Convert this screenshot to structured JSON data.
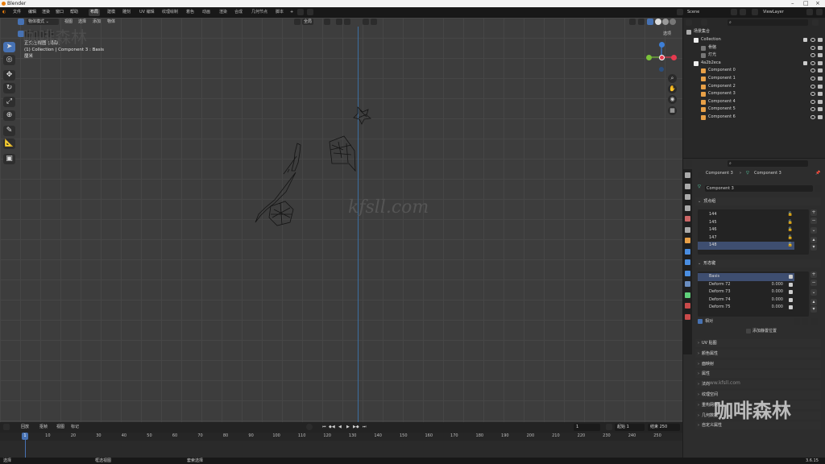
{
  "title_bar": {
    "title": "Blender"
  },
  "menus": [
    "文件",
    "编辑",
    "渲染",
    "窗口",
    "帮助"
  ],
  "workspaces": [
    {
      "label": "布局",
      "active": true
    },
    {
      "label": "建模"
    },
    {
      "label": "雕刻"
    },
    {
      "label": "UV 编辑"
    },
    {
      "label": "纹理绘制"
    },
    {
      "label": "着色"
    },
    {
      "label": "动画"
    },
    {
      "label": "渲染"
    },
    {
      "label": "合成"
    },
    {
      "label": "几何节点"
    },
    {
      "label": "脚本"
    }
  ],
  "scene": {
    "name": "Scene",
    "view_layer": "ViewLayer"
  },
  "viewport": {
    "mode": "物体模式",
    "menus": [
      "视图",
      "选择",
      "添加",
      "物体"
    ],
    "transform_orientation": "全局",
    "options_label": "选项",
    "overlay_lines": [
      "正交左视图 (局部)",
      "(1) Collection | Component 3 : Basis",
      "厘米"
    ],
    "watermark": "kfsll.com",
    "watermark_top_left": "咖啡森林",
    "gizmo": {
      "x_color": "#e63a4f",
      "y_color": "#7bc23a",
      "z_color": "#3d7fd8"
    }
  },
  "outliner": {
    "root": "场景集合",
    "rows": [
      {
        "label": "Collection",
        "depth": 1,
        "type": "collection"
      },
      {
        "label": "骨骼",
        "depth": 2,
        "type": "object"
      },
      {
        "label": "灯光",
        "depth": 2,
        "type": "object"
      },
      {
        "label": "4a2b2eca",
        "depth": 1,
        "type": "collection"
      },
      {
        "label": "Component 0",
        "depth": 2,
        "type": "mesh"
      },
      {
        "label": "Component 1",
        "depth": 2,
        "type": "mesh"
      },
      {
        "label": "Component 2",
        "depth": 2,
        "type": "mesh"
      },
      {
        "label": "Component 3",
        "depth": 2,
        "type": "mesh"
      },
      {
        "label": "Component 4",
        "depth": 2,
        "type": "mesh"
      },
      {
        "label": "Component 5",
        "depth": 2,
        "type": "mesh"
      },
      {
        "label": "Component 6",
        "depth": 2,
        "type": "mesh"
      }
    ]
  },
  "properties": {
    "breadcrumb": [
      "Component 3",
      "Component 3"
    ],
    "mesh_name": "Component 3",
    "vertex_groups_title": "顶点组",
    "vertex_groups": [
      "144",
      "145",
      "146",
      "147",
      "148"
    ],
    "shape_keys_title": "形态键",
    "shape_keys": [
      {
        "name": "Basis",
        "value": ""
      },
      {
        "name": "Deform 72",
        "value": "0.000"
      },
      {
        "name": "Deform 73",
        "value": "0.000"
      },
      {
        "name": "Deform 74",
        "value": "0.000"
      },
      {
        "name": "Deform 75",
        "value": "0.000"
      }
    ],
    "relative_label": "相对",
    "reference_label": "添加静置位置",
    "sections": [
      "UV 贴图",
      "颜色属性",
      "面映射",
      "属性",
      "法向",
      "纹理空间",
      "重构网格",
      "几何数据",
      "自定义属性"
    ]
  },
  "timeline": {
    "menus": [
      "回放",
      "抠帧",
      "视图",
      "标记"
    ],
    "current_frame": "1",
    "start_label": "起始",
    "start": "1",
    "end_label": "结束",
    "end": "250",
    "ticks": [
      "1",
      "10",
      "20",
      "30",
      "40",
      "50",
      "60",
      "70",
      "80",
      "90",
      "100",
      "110",
      "120",
      "130",
      "140",
      "150",
      "160",
      "170",
      "180",
      "190",
      "200",
      "210",
      "220",
      "230",
      "240",
      "250"
    ]
  },
  "statusbar": {
    "left": "选择",
    "middle": "框选视图",
    "right": "套索选择",
    "version": "3.6.15"
  },
  "branding": {
    "text": "咖啡森林",
    "url": "www.kfsll.com"
  }
}
